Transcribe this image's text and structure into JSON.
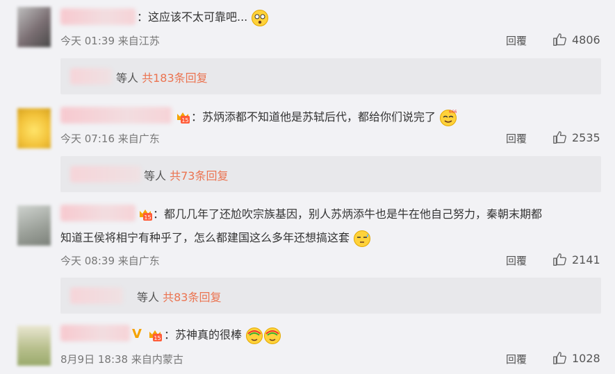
{
  "comments": [
    {
      "text": "：这应该不太可靠吧...",
      "time": "今天 01:39 来自江苏",
      "reply_label": "回覆",
      "likes": "4806",
      "replies_prefix": "等人",
      "replies_count": "共183条回复",
      "emoji": "shocked-face-icon"
    },
    {
      "text": "：苏炳添都不知道他是苏轼后代，都给你们说完了",
      "time": "今天 07:16 来自广东",
      "reply_label": "回覆",
      "likes": "2535",
      "replies_prefix": "等人",
      "replies_count": "共73条回复",
      "emoji": "666-face-icon"
    },
    {
      "text_line1": "：都几几年了还尬吹宗族基因，别人苏炳添牛也是牛在他自己努力，秦朝末期都",
      "text_line2": "知道王侯将相宁有种乎了，怎么都建国这么多年还想搞这套",
      "time": "今天 08:39 来自广东",
      "reply_label": "回覆",
      "likes": "2141",
      "replies_prefix": "等人",
      "replies_count": "共83条回复",
      "emoji": "sweat-face-icon"
    },
    {
      "text": "：苏神真的很棒",
      "time": "8月9日 18:38 来自内蒙古",
      "reply_label": "回覆",
      "likes": "1028",
      "emoji": "rainbow-face-icon"
    }
  ],
  "colors": {
    "accent": "#eb7350",
    "vip": "#f5a200",
    "text": "#333333",
    "meta": "#777777"
  }
}
